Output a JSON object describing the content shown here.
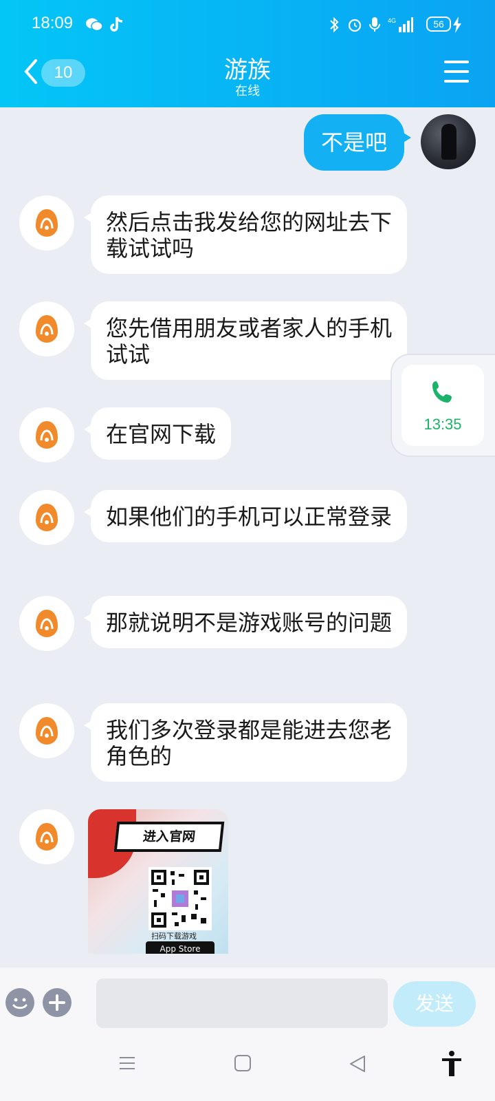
{
  "status_bar": {
    "time": "18:09",
    "network": "4G",
    "battery": "56"
  },
  "header": {
    "unread_count": "10",
    "title": "游族",
    "subtitle": "在线"
  },
  "messages": {
    "outgoing": [
      {
        "text": "不是吧"
      }
    ],
    "incoming": [
      {
        "text": "然后点击我发给您的网址去下载试试吗"
      },
      {
        "text": "您先借用朋友或者家人的手机试试"
      },
      {
        "text": "在官网下载"
      },
      {
        "text": "如果他们的手机可以正常登录"
      },
      {
        "text": "那就说明不是游戏账号的问题"
      },
      {
        "text": "我们多次登录都是能进去您老角色的"
      }
    ],
    "image_card": {
      "banner": "进入官网",
      "caption": "扫码下载游戏",
      "store_label": "App Store"
    }
  },
  "float_call": {
    "time": "13:35"
  },
  "input_bar": {
    "placeholder": "",
    "send_label": "发送"
  },
  "colors": {
    "header_start": "#04c6f6",
    "header_end": "#0aa3f3",
    "outgoing_bubble": "#13b1f4",
    "call_green": "#1bb36a",
    "bot_orange": "#f08a2a"
  }
}
